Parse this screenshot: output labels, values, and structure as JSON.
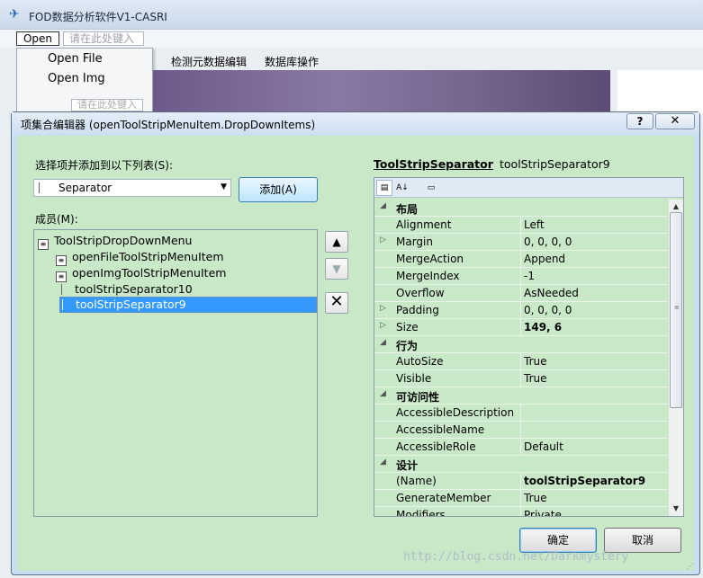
{
  "window": {
    "title": "FOD数据分析软件V1-CASRI"
  },
  "menubar": {
    "open_label": "Open",
    "type_here": "请在此处键入"
  },
  "open_menu": {
    "items": [
      "Open File",
      "Open Img"
    ],
    "type_here": "请在此处键入"
  },
  "bg_tabs": [
    "检测元数据编辑",
    "数据库操作"
  ],
  "dialog": {
    "title": "项集合编辑器 (openToolStripMenuItem.DropDownItems)",
    "help_label": "?",
    "close_label": "✕",
    "select_label": "选择项并添加到以下列表(S):",
    "type_value": "Separator",
    "add_label": "添加(A)",
    "members_label": "成员(M):",
    "members": [
      {
        "label": "ToolStripDropDownMenu",
        "kind": "root"
      },
      {
        "label": "openFileToolStripMenuItem",
        "kind": "item"
      },
      {
        "label": "openImgToolStripMenuItem",
        "kind": "item"
      },
      {
        "label": "toolStripSeparator10",
        "kind": "separator"
      },
      {
        "label": "toolStripSeparator9",
        "kind": "separator",
        "selected": true
      }
    ],
    "up_icon": "▲",
    "down_icon": "▼",
    "delete_icon": "✕",
    "prop_title": "ToolStripSeparator",
    "prop_subtitle": "toolStripSeparator9",
    "properties": [
      {
        "name": "布局",
        "category": true
      },
      {
        "name": "Alignment",
        "value": "Left"
      },
      {
        "name": "Margin",
        "value": "0, 0, 0, 0",
        "expandable": true
      },
      {
        "name": "MergeAction",
        "value": "Append"
      },
      {
        "name": "MergeIndex",
        "value": "-1"
      },
      {
        "name": "Overflow",
        "value": "AsNeeded"
      },
      {
        "name": "Padding",
        "value": "0, 0, 0, 0",
        "expandable": true
      },
      {
        "name": "Size",
        "value": "149, 6",
        "expandable": true,
        "bold": true
      },
      {
        "name": "行为",
        "category": true
      },
      {
        "name": "AutoSize",
        "value": "True"
      },
      {
        "name": "Visible",
        "value": "True"
      },
      {
        "name": "可访问性",
        "category": true
      },
      {
        "name": "AccessibleDescription",
        "value": ""
      },
      {
        "name": "AccessibleName",
        "value": ""
      },
      {
        "name": "AccessibleRole",
        "value": "Default"
      },
      {
        "name": "设计",
        "category": true
      },
      {
        "name": "(Name)",
        "value": "toolStripSeparator9",
        "bold": true
      },
      {
        "name": "GenerateMember",
        "value": "True"
      },
      {
        "name": "Modifiers",
        "value": "Private"
      }
    ],
    "ok_label": "确定",
    "cancel_label": "取消"
  },
  "watermark": "http://blog.csdn.net/Darkmystery"
}
